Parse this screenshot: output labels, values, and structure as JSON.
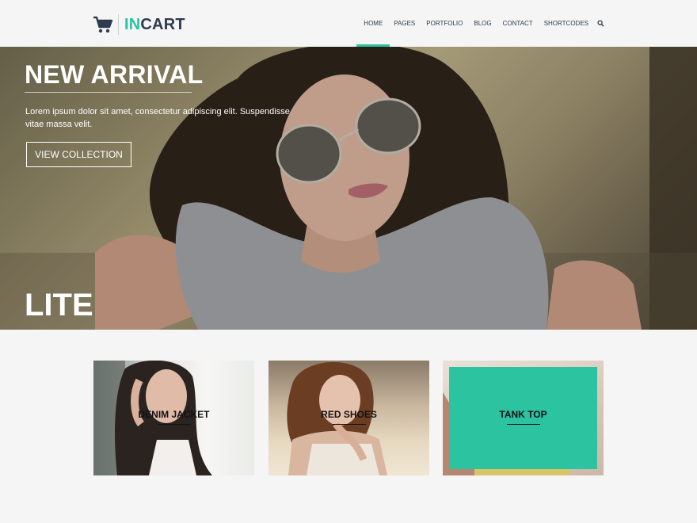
{
  "brand": {
    "prefix": "IN",
    "suffix": "CART"
  },
  "nav": {
    "items": [
      {
        "label": "HOME",
        "active": true
      },
      {
        "label": "PAGES",
        "active": false
      },
      {
        "label": "PORTFOLIO",
        "active": false
      },
      {
        "label": "BLOG",
        "active": false
      },
      {
        "label": "CONTACT",
        "active": false
      },
      {
        "label": "SHORTCODES",
        "active": false
      }
    ],
    "search_icon": "search-icon"
  },
  "hero": {
    "title": "NEW ARRIVAL",
    "text": "Lorem ipsum dolor sit amet, consectetur adipiscing elit. Suspendisse vitae massa velit.",
    "button": "VIEW COLLECTION",
    "tag": "LITE"
  },
  "products": [
    {
      "label": "DENIM JACKET",
      "highlighted": false
    },
    {
      "label": "RED SHOES",
      "highlighted": false
    },
    {
      "label": "TANK TOP",
      "highlighted": true
    }
  ],
  "colors": {
    "accent": "#2bc3a0",
    "dark_text": "#2e3b4e",
    "background": "#f5f5f5"
  }
}
